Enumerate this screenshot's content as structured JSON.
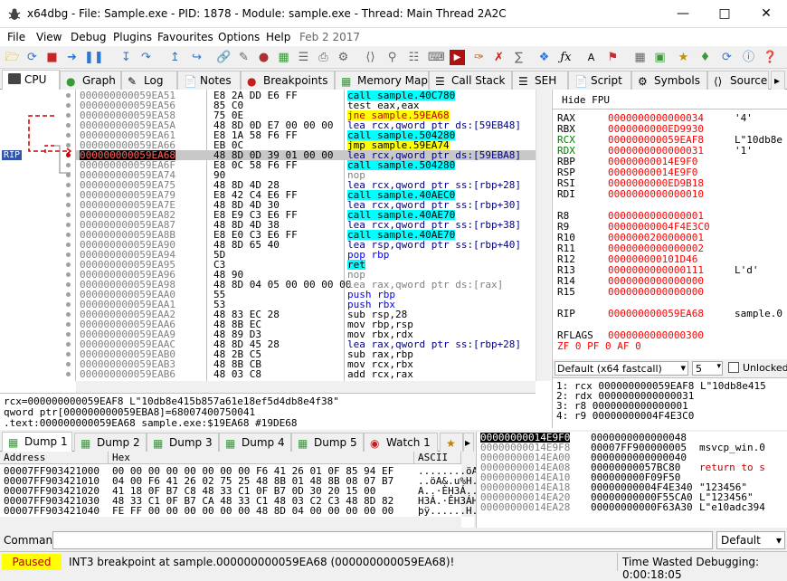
{
  "window": {
    "title": "x64dbg - File: Sample.exe - PID: 1878 - Module: sample.exe - Thread: Main Thread 2A2C"
  },
  "menu": [
    "File",
    "View",
    "Debug",
    "Plugins",
    "Favourites",
    "Options",
    "Help",
    "Feb 2 2017"
  ],
  "tabs": [
    "CPU",
    "Graph",
    "Log",
    "Notes",
    "Breakpoints",
    "Memory Map",
    "Call Stack",
    "SEH",
    "Script",
    "Symbols",
    "Source"
  ],
  "disasm": [
    {
      "a": "000000000059EA51",
      "b": "E8 2A DD E6 FF",
      "i": "call sample.40C780",
      "k": "call"
    },
    {
      "a": "000000000059EA56",
      "b": "85 C0",
      "i": "test eax,eax",
      "k": ""
    },
    {
      "a": "000000000059EA58",
      "b": "75 0E",
      "i": "jne sample.59EA68",
      "k": "jmp"
    },
    {
      "a": "000000000059EA5A",
      "b": "48 8D 0D E7 00 00 00",
      "i": "lea rcx,qword ptr ds:[59EB48]",
      "k": "mem"
    },
    {
      "a": "000000000059EA61",
      "b": "E8 1A 58 F6 FF",
      "i": "call sample.504280",
      "k": "call"
    },
    {
      "a": "000000000059EA66",
      "b": "EB 0C",
      "i": "jmp sample.59EA74",
      "k": "jmp"
    },
    {
      "a": "000000000059EA68",
      "b": "48 8D 0D 39 01 00 00",
      "i": "lea rcx,qword ptr ds:[59EBA8]",
      "k": "rip"
    },
    {
      "a": "000000000059EA6F",
      "b": "E8 0C 58 F6 FF",
      "i": "call sample.504280",
      "k": "call"
    },
    {
      "a": "000000000059EA74",
      "b": "90",
      "i": "nop",
      "k": "nop"
    },
    {
      "a": "000000000059EA75",
      "b": "48 8D 4D 28",
      "i": "lea rcx,qword ptr ss:[rbp+28]",
      "k": "mem"
    },
    {
      "a": "000000000059EA79",
      "b": "E8 42 C4 E6 FF",
      "i": "call sample.40AEC0",
      "k": "call"
    },
    {
      "a": "000000000059EA7E",
      "b": "48 8D 4D 30",
      "i": "lea rcx,qword ptr ss:[rbp+30]",
      "k": "mem"
    },
    {
      "a": "000000000059EA82",
      "b": "E8 E9 C3 E6 FF",
      "i": "call sample.40AE70",
      "k": "call"
    },
    {
      "a": "000000000059EA87",
      "b": "48 8D 4D 38",
      "i": "lea rcx,qword ptr ss:[rbp+38]",
      "k": "mem"
    },
    {
      "a": "000000000059EA8B",
      "b": "E8 E0 C3 E6 FF",
      "i": "call sample.40AE70",
      "k": "call"
    },
    {
      "a": "000000000059EA90",
      "b": "48 8D 65 40",
      "i": "lea rsp,qword ptr ss:[rbp+40]",
      "k": "mem"
    },
    {
      "a": "000000000059EA94",
      "b": "5D",
      "i": "pop rbp",
      "k": "stack"
    },
    {
      "a": "000000000059EA95",
      "b": "C3",
      "i": "ret",
      "k": "ret"
    },
    {
      "a": "000000000059EA96",
      "b": "48 90",
      "i": "nop",
      "k": "nop"
    },
    {
      "a": "000000000059EA98",
      "b": "48 8D 04 05 00 00 00 00",
      "i": "lea rax,qword ptr ds:[rax]",
      "k": "grey"
    },
    {
      "a": "000000000059EAA0",
      "b": "55",
      "i": "push rbp",
      "k": "stack"
    },
    {
      "a": "000000000059EAA1",
      "b": "53",
      "i": "push rbx",
      "k": "stack"
    },
    {
      "a": "000000000059EAA2",
      "b": "48 83 EC 28",
      "i": "sub rsp,28",
      "k": ""
    },
    {
      "a": "000000000059EAA6",
      "b": "48 8B EC",
      "i": "mov rbp,rsp",
      "k": ""
    },
    {
      "a": "000000000059EAA9",
      "b": "48 89 D3",
      "i": "mov rbx,rdx",
      "k": ""
    },
    {
      "a": "000000000059EAAC",
      "b": "48 8D 45 28",
      "i": "lea rax,qword ptr ss:[rbp+28]",
      "k": "mem"
    },
    {
      "a": "000000000059EAB0",
      "b": "48 2B C5",
      "i": "sub rax,rbp",
      "k": ""
    },
    {
      "a": "000000000059EAB3",
      "b": "48 8B CB",
      "i": "mov rcx,rbx",
      "k": ""
    },
    {
      "a": "000000000059EAB6",
      "b": "48 03 C8",
      "i": "add rcx,rax",
      "k": ""
    }
  ],
  "rip_label": "RIP",
  "info": [
    "rcx=000000000059EAF8 L\"10db8e415b857a61e18ef5d4db8e4f38\"",
    "qword ptr[000000000059EBA8]=68007400750041",
    ".text:000000000059EA68 sample.exe:$19EA68 #19DE68"
  ],
  "fpu_label": "Hide FPU",
  "regs": [
    {
      "n": "RAX",
      "v": "0000000000000034",
      "c": "'4'"
    },
    {
      "n": "RBX",
      "v": "0000000000ED9930",
      "c": ""
    },
    {
      "n": "RCX",
      "v": "000000000059EAF8",
      "c": "L\"10db8e"
    },
    {
      "n": "RDX",
      "v": "0000000000000031",
      "c": "'1'"
    },
    {
      "n": "RBP",
      "v": "00000000014E9F0",
      "c": ""
    },
    {
      "n": "RSP",
      "v": "00000000014E9F0",
      "c": ""
    },
    {
      "n": "RSI",
      "v": "0000000000ED9B18",
      "c": ""
    },
    {
      "n": "RDI",
      "v": "0000000000000010",
      "c": ""
    },
    {
      "n": "",
      "v": "",
      "c": ""
    },
    {
      "n": "R8",
      "v": "0000000000000001",
      "c": ""
    },
    {
      "n": "R9",
      "v": "00000000004F4E3C0",
      "c": ""
    },
    {
      "n": "R10",
      "v": "0000000200000001",
      "c": ""
    },
    {
      "n": "R11",
      "v": "0000000000000002",
      "c": ""
    },
    {
      "n": "R12",
      "v": "000000000101D46",
      "c": ""
    },
    {
      "n": "R13",
      "v": "0000000000000111",
      "c": "L'd'"
    },
    {
      "n": "R14",
      "v": "0000000000000000",
      "c": ""
    },
    {
      "n": "R15",
      "v": "0000000000000000",
      "c": ""
    },
    {
      "n": "",
      "v": "",
      "c": ""
    },
    {
      "n": "RIP",
      "v": "000000000059EA68",
      "c": "sample.0"
    },
    {
      "n": "",
      "v": "",
      "c": ""
    },
    {
      "n": "RFLAGS",
      "v": "0000000000000300",
      "c": ""
    },
    {
      "n": "ZF 0  PF 0  AF 0",
      "v": "",
      "c": ""
    }
  ],
  "callconv": {
    "value": "Default (x64 fastcall)",
    "count": "5",
    "unlocked": "Unlocked"
  },
  "args": [
    "1: rcx 000000000059EAF8 L\"10db8e415",
    "2: rdx 0000000000000031",
    "3: r8 0000000000000001",
    "4: r9 00000000004F4E3C0"
  ],
  "dumptabs": [
    "Dump 1",
    "Dump 2",
    "Dump 3",
    "Dump 4",
    "Dump 5",
    "Watch 1"
  ],
  "dump_headers": [
    "Address",
    "Hex",
    "ASCII"
  ],
  "dump": [
    {
      "a": "00007FF903421000",
      "h": "00 00 00 00 00 00 00 00 F6 41 26 01 0F 85 94 EF",
      "s": "........öA&...."
    },
    {
      "a": "00007FF903421010",
      "h": "04 00 F6 41 26 02 75 25 48 8B 01 48 8B 08 07 B7",
      "s": "..öA&.u%H..H..."
    },
    {
      "a": "00007FF903421020",
      "h": "41 18 0F B7 C8 48 33 C1 0F B7 0D 30 20 15 00",
      "s": "A..·ÈH3Á..·.0 .."
    },
    {
      "a": "00007FF903421030",
      "h": "48 33 C1 0F B7 CA 48 33 C1 48 03 C2 C3 48 8D 82",
      "s": "H3Á.·ÊH3ÁH.ÂÃH.."
    },
    {
      "a": "00007FF903421040",
      "h": "FE FF 00 00 00 00 00 00 48 8D 04 00 00 00 00 00",
      "s": "þÿ......H......"
    }
  ],
  "stack": [
    {
      "a": "00000000014E9F0",
      "v": "0000000000000048",
      "c": ""
    },
    {
      "a": "00000000014E9F8",
      "v": "00007FF900000005",
      "c": "msvcp_win.0"
    },
    {
      "a": "00000000014EA00",
      "v": "0000000000000040",
      "c": ""
    },
    {
      "a": "00000000014EA08",
      "v": "00000000057BC80",
      "c": "return to s"
    },
    {
      "a": "00000000014EA10",
      "v": "000000000F09F50",
      "c": ""
    },
    {
      "a": "00000000014EA18",
      "v": "00000000004F4E340",
      "c": "\"123456\""
    },
    {
      "a": "00000000014EA20",
      "v": "00000000000F55CA0",
      "c": "L\"123456\""
    },
    {
      "a": "00000000014EA28",
      "v": "00000000000F63A30",
      "c": "L\"e10adc394"
    }
  ],
  "cmd": {
    "label": "Command:",
    "default": "Default"
  },
  "status": {
    "state": "Paused",
    "msg": "INT3 breakpoint at sample.000000000059EA68 (000000000059EA68)!",
    "time": "Time Wasted Debugging: 0:00:18:05"
  }
}
